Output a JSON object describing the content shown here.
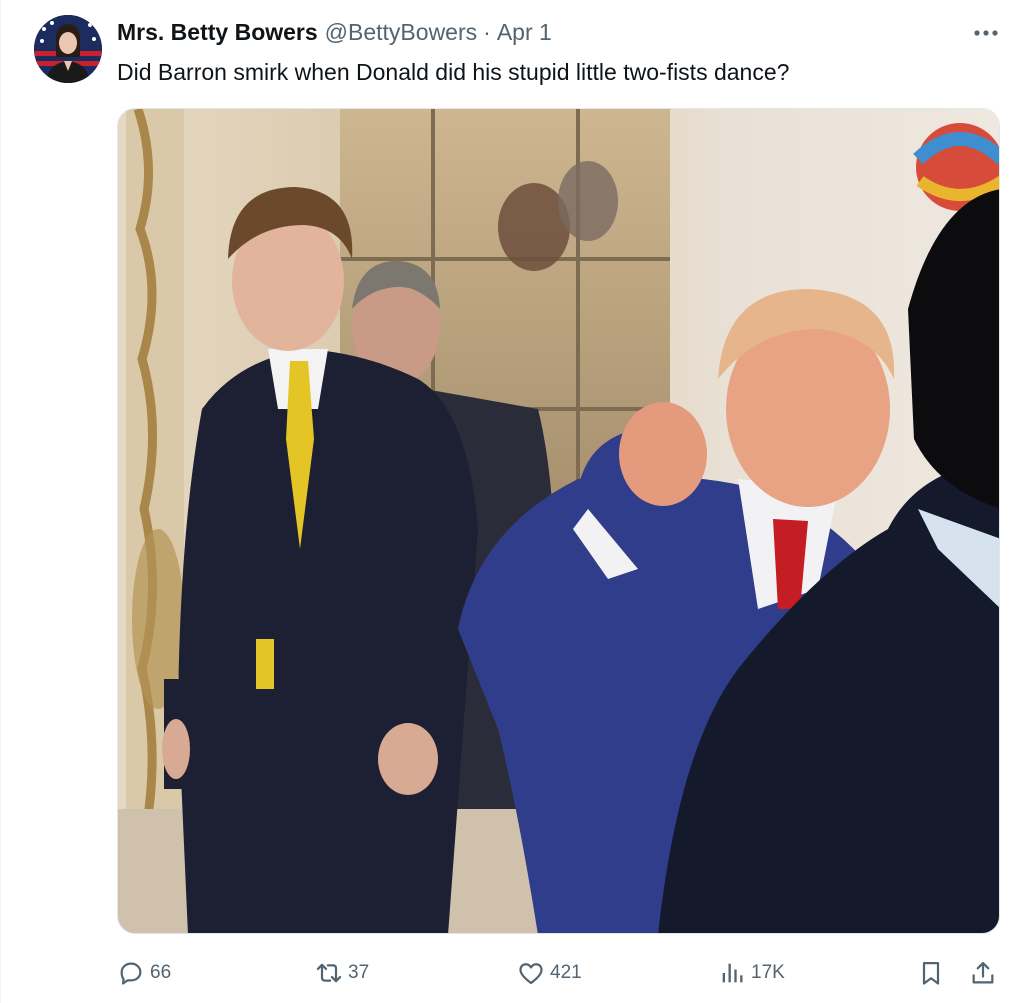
{
  "tweet": {
    "author_name": "Mrs. Betty Bowers",
    "author_handle": "@BettyBowers",
    "separator": "·",
    "date": "Apr 1",
    "text": "Did Barron smirk when Donald did his stupid little two-fists dance?",
    "more_icon": "more-horizontal-icon",
    "media": {
      "type": "video-still",
      "description_icon": "photo"
    }
  },
  "actions": {
    "replies": "66",
    "reposts": "37",
    "likes": "421",
    "views": "17K",
    "icons": [
      "reply-icon",
      "repost-icon",
      "like-icon",
      "views-icon",
      "bookmark-icon",
      "share-icon"
    ]
  },
  "colors": {
    "text": "#0f1419",
    "secondary": "#536471",
    "background": "#ffffff"
  }
}
